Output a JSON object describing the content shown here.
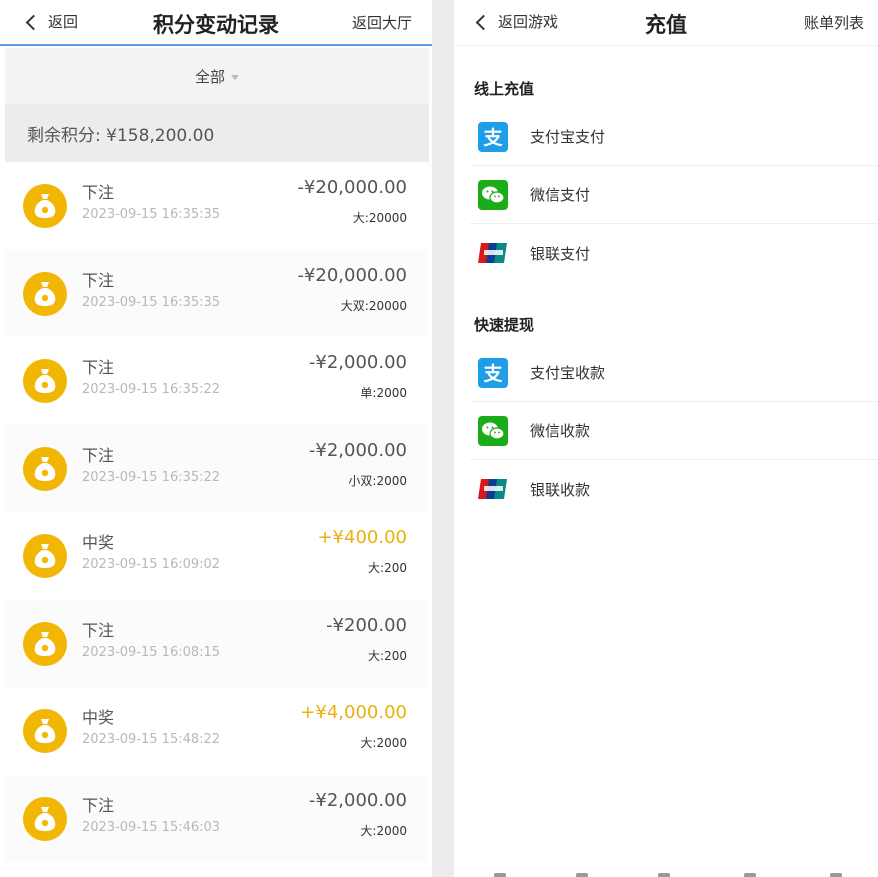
{
  "left": {
    "back_label": "返回",
    "title": "积分变动记录",
    "lobby_label": "返回大厅",
    "filter_label": "全部",
    "balance_text": "剩余积分: ¥158,200.00",
    "records": [
      {
        "type": "下注",
        "time": "2023-09-15 16:35:35",
        "amount": "-¥20,000.00",
        "note": "大:20000",
        "win": false
      },
      {
        "type": "下注",
        "time": "2023-09-15 16:35:35",
        "amount": "-¥20,000.00",
        "note": "大双:20000",
        "win": false
      },
      {
        "type": "下注",
        "time": "2023-09-15 16:35:22",
        "amount": "-¥2,000.00",
        "note": "单:2000",
        "win": false
      },
      {
        "type": "下注",
        "time": "2023-09-15 16:35:22",
        "amount": "-¥2,000.00",
        "note": "小双:2000",
        "win": false
      },
      {
        "type": "中奖",
        "time": "2023-09-15 16:09:02",
        "amount": "+¥400.00",
        "note": "大:200",
        "win": true
      },
      {
        "type": "下注",
        "time": "2023-09-15 16:08:15",
        "amount": "-¥200.00",
        "note": "大:200",
        "win": false
      },
      {
        "type": "中奖",
        "time": "2023-09-15 15:48:22",
        "amount": "+¥4,000.00",
        "note": "大:2000",
        "win": true
      },
      {
        "type": "下注",
        "time": "2023-09-15 15:46:03",
        "amount": "-¥2,000.00",
        "note": "大:2000",
        "win": false
      }
    ]
  },
  "right": {
    "back_label": "返回游戏",
    "title": "充值",
    "bill_label": "账单列表",
    "online_section": "线上充值",
    "online_methods": [
      {
        "icon": "alipay-icon",
        "label": "支付宝支付"
      },
      {
        "icon": "wechat-icon",
        "label": "微信支付"
      },
      {
        "icon": "unionpay-icon",
        "label": "银联支付"
      }
    ],
    "withdraw_section": "快速提现",
    "withdraw_methods": [
      {
        "icon": "alipay-icon",
        "label": "支付宝收款"
      },
      {
        "icon": "wechat-icon",
        "label": "微信收款"
      },
      {
        "icon": "unionpay-icon",
        "label": "银联收款"
      }
    ],
    "alipay_glyph": "支"
  },
  "colors": {
    "accent_blue": "#5b9fdc",
    "coin_gold": "#f2b705",
    "win_gold": "#eab012",
    "alipay_blue": "#1e9ee8",
    "wechat_green": "#1aad19"
  }
}
